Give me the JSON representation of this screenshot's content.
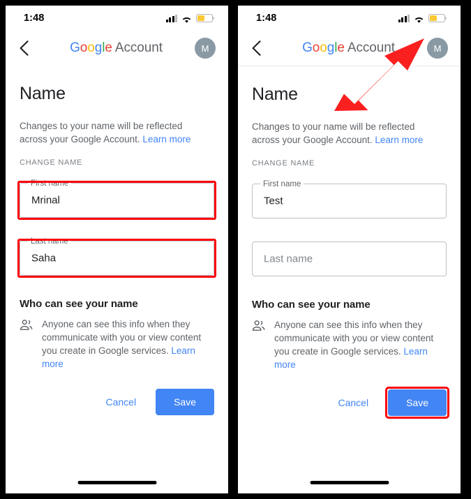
{
  "status_bar": {
    "time": "1:48",
    "cellular_icon": "cellular-bars-icon",
    "wifi_icon": "wifi-icon",
    "battery_icon": "battery-low-icon",
    "battery_color": "#fcc934"
  },
  "app_bar": {
    "back_icon": "back-chevron-icon",
    "logo_letters": [
      "G",
      "o",
      "o",
      "g",
      "l",
      "e"
    ],
    "logo_colors": [
      "#4285f4",
      "#ea4335",
      "#fbbc05",
      "#4285f4",
      "#34a853",
      "#ea4335"
    ],
    "account_word": " Account",
    "avatar_initial": "M",
    "avatar_color": "#8a9aa5"
  },
  "page": {
    "title": "Name",
    "description": "Changes to your name will be reflected across your Google Account. ",
    "description_link": "Learn more",
    "section_label": "CHANGE NAME"
  },
  "panels": [
    {
      "id": "left",
      "first_name": {
        "label": "First name",
        "value": "Mrinal",
        "placeholder": "First name",
        "highlighted": true
      },
      "last_name": {
        "label": "Last name",
        "value": "Saha",
        "placeholder": "Last name",
        "highlighted": true
      },
      "save_highlighted": false,
      "arrow_visible": false
    },
    {
      "id": "right",
      "first_name": {
        "label": "First name",
        "value": "Test",
        "placeholder": "First name",
        "highlighted": false
      },
      "last_name": {
        "label": "Last name",
        "value": "",
        "placeholder": "Last name",
        "highlighted": false
      },
      "save_highlighted": true,
      "arrow_visible": true
    }
  ],
  "who_can_see": {
    "title": "Who can see your name",
    "icon": "people-group-icon",
    "text": "Anyone can see this info when they communicate with you or view content you create in Google services. ",
    "link": "Learn more"
  },
  "actions": {
    "cancel_label": "Cancel",
    "save_label": "Save",
    "save_color": "#4285f4",
    "cancel_color": "#4285f4"
  },
  "annotations": {
    "highlight_color": "#fb0007",
    "arrow_color": "#fb2020",
    "arrow_direction": "up-right",
    "arrow_target": "save-button"
  }
}
